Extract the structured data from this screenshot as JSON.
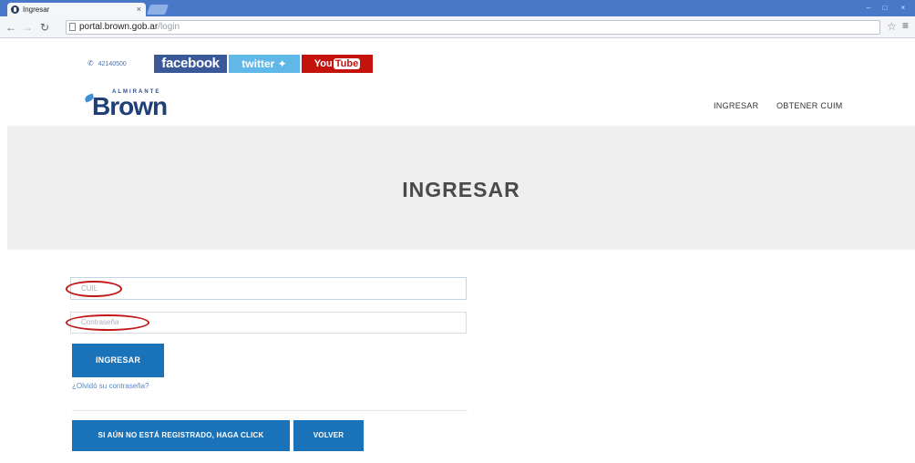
{
  "browser": {
    "tab_title": "Ingresar",
    "tab_close": "×",
    "url_host": "portal.brown.gob.ar",
    "url_path": "/login"
  },
  "social": {
    "phone": "42140500",
    "facebook": "facebook",
    "twitter": "twitter",
    "youtube_you": "You",
    "youtube_tube": "Tube"
  },
  "header": {
    "logo_small": "ALMIRANTE",
    "logo_main": "Brown",
    "nav": [
      "INGRESAR",
      "OBTENER CUIM"
    ]
  },
  "hero": {
    "title": "INGRESAR"
  },
  "form": {
    "cuil_placeholder": "CUIL",
    "password_placeholder": "Contraseña",
    "submit_label": "INGRESAR",
    "forgot_label": "¿Olvidó su contraseña?",
    "register_label": "SI AÚN NO ESTÁ REGISTRADO, HAGA CLICK",
    "back_label": "VOLVER"
  },
  "colors": {
    "primary_button": "#1a72b8",
    "facebook": "#3b5998",
    "twitter": "#5fb8e8",
    "youtube": "#c4120c",
    "annotation_mark": "#c01818"
  }
}
